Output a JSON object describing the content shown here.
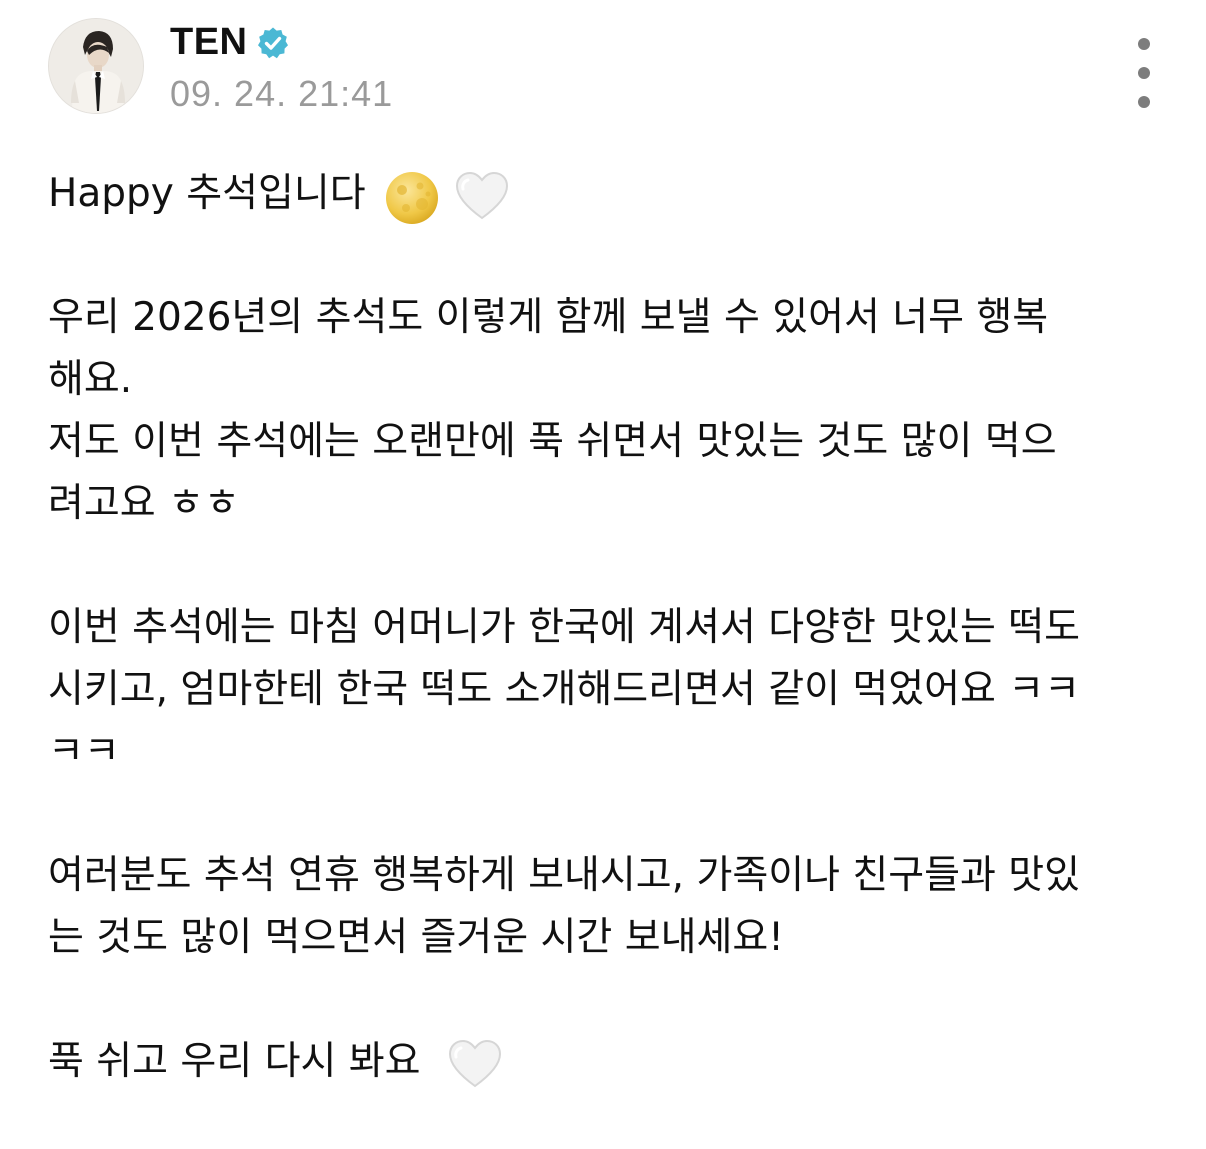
{
  "author": {
    "name": "TEN",
    "verified": true,
    "timestamp": "09. 24. 21:41",
    "avatar_icon": "profile-photo"
  },
  "colors": {
    "verified_badge": "#4bb8d4",
    "timestamp": "#9a9a9a",
    "text": "#111111",
    "more_dots": "#7d7d7d"
  },
  "menu": {
    "more_icon": "more-vertical-icon"
  },
  "post": {
    "line1_text": "Happy 추석입니다",
    "line1_emojis": [
      "full-moon-face-icon",
      "white-heart-icon"
    ],
    "para2": [
      "우리 2026년의 추석도 이렇게 함께 보낼 수 있어서 너무 행복",
      "해요.",
      "저도 이번 추석에는 오랜만에 푹 쉬면서 맛있는 것도 많이 먹으",
      "려고요 ㅎㅎ"
    ],
    "para3": [
      "이번 추석에는 마침 어머니가 한국에 계셔서 다양한 맛있는 떡도",
      "시키고, 엄마한테 한국 떡도 소개해드리면서 같이 먹었어요 ㅋㅋ",
      "ㅋㅋ"
    ],
    "para4": [
      "여러분도 추석 연휴 행복하게 보내시고, 가족이나 친구들과 맛있",
      "는 것도 많이 먹으면서 즐거운 시간 보내세요!"
    ],
    "last_line_text": "푹 쉬고 우리 다시 봐요",
    "last_line_emoji": "white-heart-icon"
  }
}
